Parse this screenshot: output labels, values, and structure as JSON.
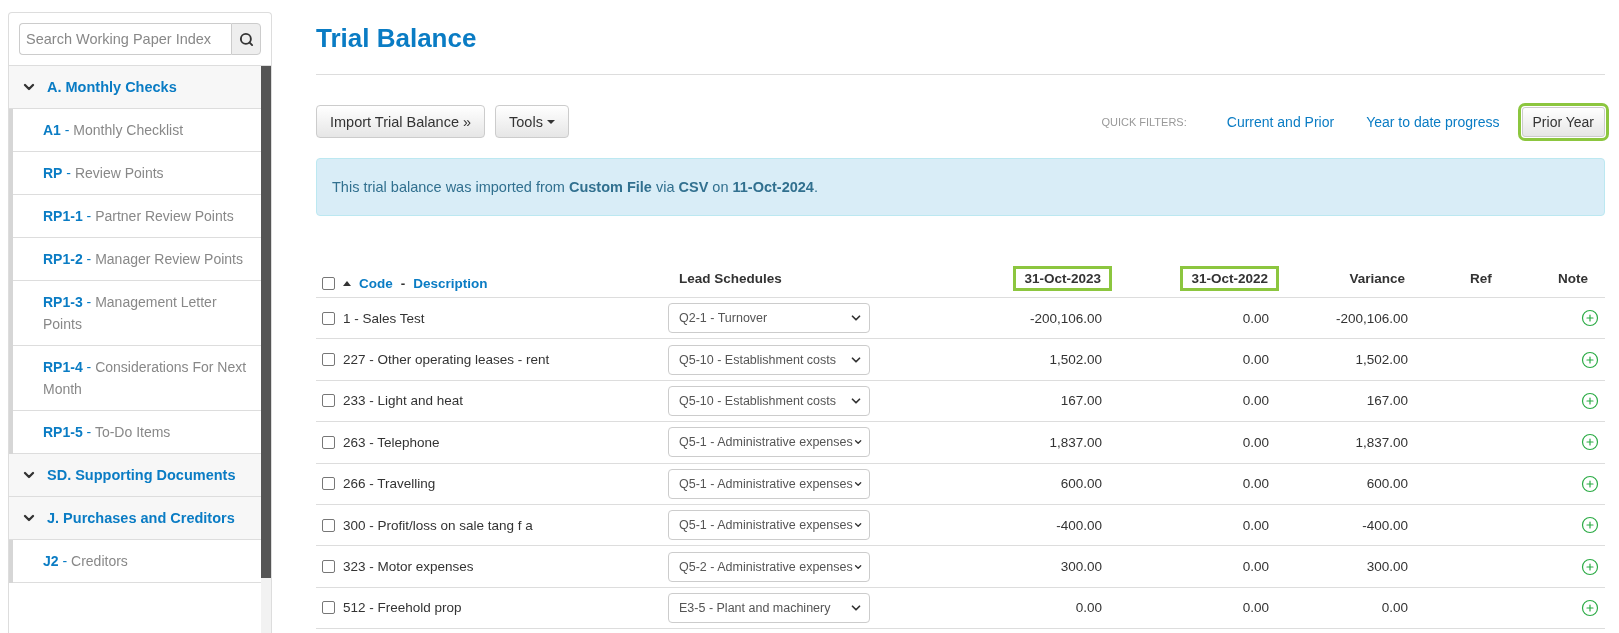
{
  "sidebar": {
    "search": {
      "placeholder": "Search Working Paper Index"
    },
    "sections": [
      {
        "title": "A. Monthly Checks",
        "expanded": true,
        "children": [
          {
            "code": "**A1** -",
            "title": "Monthly Checklist"
          },
          {
            "code": "**RP** -",
            "title": "Review Points"
          },
          {
            "code": "**RP1-1** -",
            "title": "Partner Review Points"
          },
          {
            "code": "**RP1-2** -",
            "title": "Manager Review Points"
          },
          {
            "code": "**RP1-3** -",
            "title": "Management Letter Points"
          },
          {
            "code": "**RP1-4** -",
            "title": "Considerations For Next Month"
          },
          {
            "code": "**RP1-5** -",
            "title": "To-Do Items"
          }
        ]
      },
      {
        "title": "SD. Supporting Documents",
        "expanded": true
      },
      {
        "title": "J. Purchases and Creditors",
        "expanded": true,
        "children": [
          {
            "code": "**J2** -",
            "title": "Creditors"
          }
        ]
      }
    ]
  },
  "page_title": "Trial Balance",
  "toolbar": {
    "buttons": [
      {
        "label": "Import Trial Balance »",
        "kind": "plain"
      },
      {
        "label": "Tools",
        "kind": "dropdown"
      }
    ],
    "quick_filters_label": "QUICK FILTERS:",
    "quick_filters": [
      {
        "label": "Current and Prior",
        "selected": false,
        "highlighted": false
      },
      {
        "label": "Year to date progress",
        "selected": false,
        "highlighted": false
      },
      {
        "label": "Prior Year",
        "selected": true,
        "highlighted": true
      }
    ]
  },
  "alert": "This trial balance was imported from **Custom File** via **CSV** on **11-Oct-2024**.",
  "table": {
    "select_all": {
      "checked": false
    },
    "code_label": "Code",
    "separator": "-",
    "description_label": "Description",
    "columns": [
      {
        "label": "Lead Schedules",
        "highlighted": false
      },
      {
        "label": "31-Oct-2023",
        "highlighted": true
      },
      {
        "label": "31-Oct-2022",
        "highlighted": true
      },
      {
        "label": "Variance",
        "highlighted": false
      },
      {
        "label": "Ref",
        "highlighted": false
      },
      {
        "label": "Note",
        "highlighted": false
      }
    ],
    "rows": [
      {
        "checked": false,
        "account": "1 - Sales Test",
        "lead_schedule": "Q2-1 - Turnover",
        "current": "-200,106.00",
        "prior": "0.00",
        "variance": "-200,106.00"
      },
      {
        "checked": false,
        "account": "227 - Other operating leases - rent",
        "lead_schedule": "Q5-10 - Establishment costs",
        "current": "1,502.00",
        "prior": "0.00",
        "variance": "1,502.00"
      },
      {
        "checked": false,
        "account": "233 - Light and heat",
        "lead_schedule": "Q5-10 - Establishment costs",
        "current": "167.00",
        "prior": "0.00",
        "variance": "167.00"
      },
      {
        "checked": false,
        "account": "263 - Telephone",
        "lead_schedule": "Q5-1 - Administrative expenses",
        "current": "1,837.00",
        "prior": "0.00",
        "variance": "1,837.00"
      },
      {
        "checked": false,
        "account": "266 - Travelling",
        "lead_schedule": "Q5-1 - Administrative expenses",
        "current": "600.00",
        "prior": "0.00",
        "variance": "600.00"
      },
      {
        "checked": false,
        "account": "300 - Profit/loss on sale tang f a",
        "lead_schedule": "Q5-1 - Administrative expenses",
        "current": "-400.00",
        "prior": "0.00",
        "variance": "-400.00"
      },
      {
        "checked": false,
        "account": "323 - Motor expenses",
        "lead_schedule": "Q5-2 - Administrative expenses",
        "current": "300.00",
        "prior": "0.00",
        "variance": "300.00"
      },
      {
        "checked": false,
        "account": "512 - Freehold prop",
        "lead_schedule": "E3-5 - Plant and machinery",
        "current": "0.00",
        "prior": "0.00",
        "variance": "0.00"
      }
    ]
  }
}
